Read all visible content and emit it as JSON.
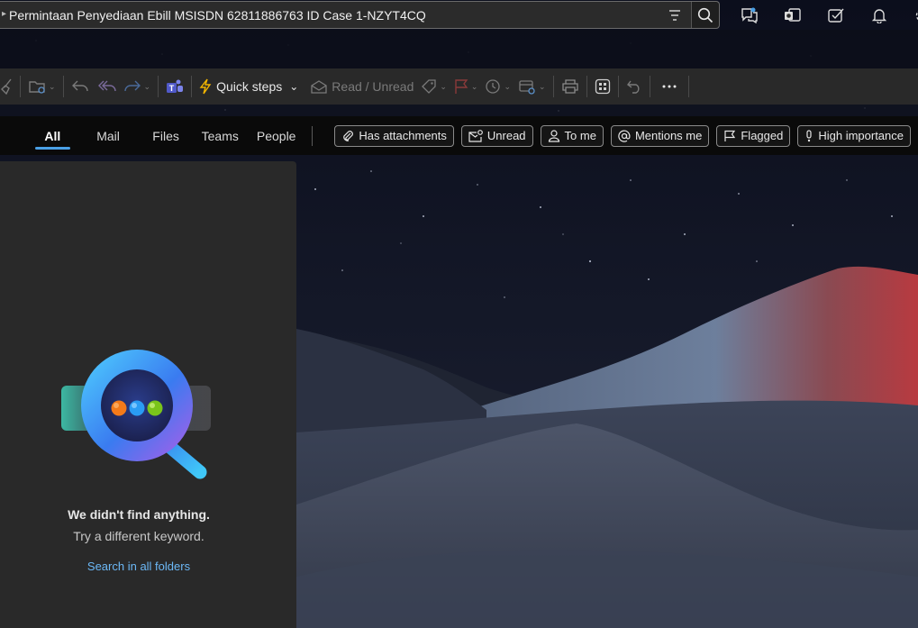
{
  "search": {
    "query": "Permintaan Penyediaan Ebill MSISDN 62811886763 ID Case 1-NZYT4CQ",
    "filter_icon": "filter-icon",
    "search_icon": "search-icon"
  },
  "top_icons": [
    "chat-icon",
    "outlook-icon",
    "todo-icon",
    "bell-icon",
    "gear-icon"
  ],
  "ribbon": {
    "quick_steps_label": "Quick steps",
    "read_unread_label": "Read / Unread",
    "icons": [
      "sweep-icon",
      "move-icon",
      "undo-icon",
      "reply-all-icon",
      "forward-icon",
      "teams-icon",
      "lightning-icon",
      "envelope-icon",
      "tag-icon",
      "flag-icon",
      "clock-icon",
      "rules-icon",
      "print-icon",
      "apps-icon",
      "undo-icon",
      "more-icon"
    ]
  },
  "tabs": [
    {
      "label": "All",
      "active": true
    },
    {
      "label": "Mail",
      "active": false
    },
    {
      "label": "Files",
      "active": false
    },
    {
      "label": "Teams",
      "active": false
    },
    {
      "label": "People",
      "active": false
    }
  ],
  "chips": [
    {
      "label": "Has attachments",
      "icon": "paperclip-icon"
    },
    {
      "label": "Unread",
      "icon": "mail-unread-icon"
    },
    {
      "label": "To me",
      "icon": "person-icon"
    },
    {
      "label": "Mentions me",
      "icon": "at-icon"
    },
    {
      "label": "Flagged",
      "icon": "flag-icon"
    },
    {
      "label": "High importance",
      "icon": "exclamation-icon"
    }
  ],
  "results": {
    "title": "We didn't find anything.",
    "subtitle": "Try a different keyword.",
    "link": "Search in all folders"
  },
  "colors": {
    "accent": "#4aa0e6",
    "link": "#6cb8f6",
    "pane": "#292929",
    "ribbon": "#292929",
    "quick_steps_icon": "#f2b500"
  }
}
